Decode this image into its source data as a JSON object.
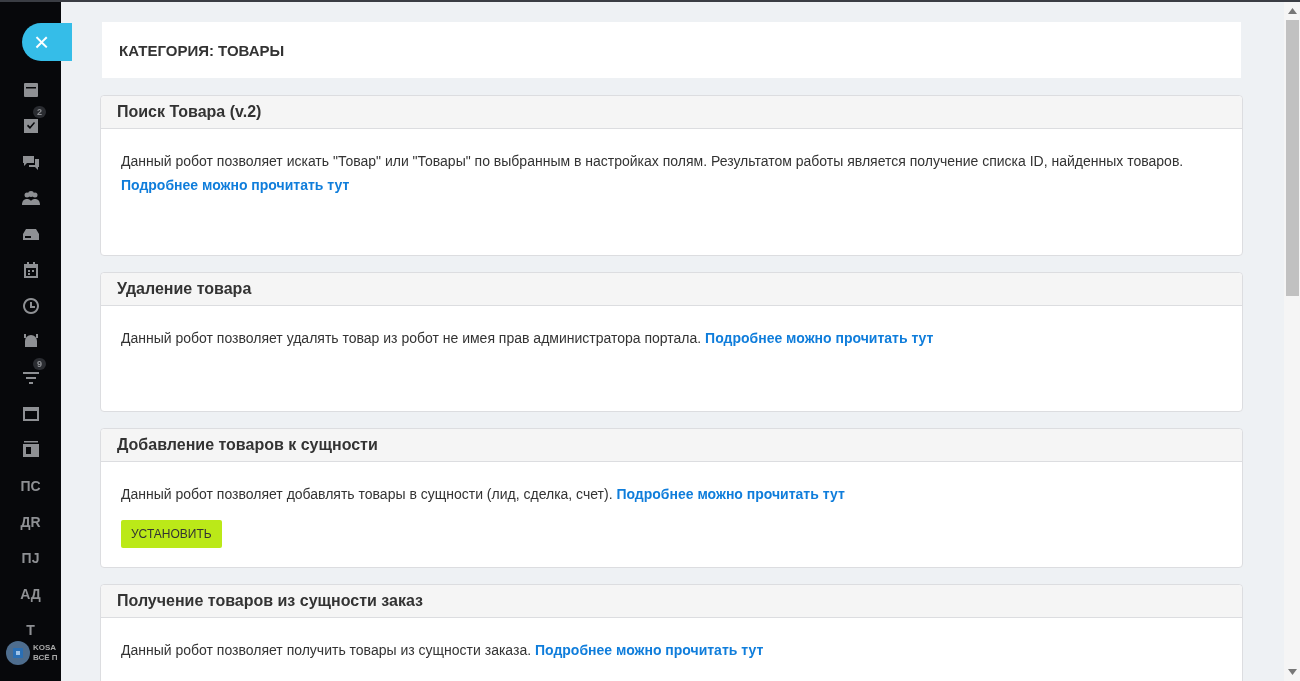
{
  "sidebar": {
    "items": [
      {
        "kind": "icon"
      },
      {
        "kind": "icon",
        "badge": "2"
      },
      {
        "kind": "icon"
      },
      {
        "kind": "icon"
      },
      {
        "kind": "icon"
      },
      {
        "kind": "icon"
      },
      {
        "kind": "icon"
      },
      {
        "kind": "icon"
      },
      {
        "kind": "icon",
        "badge": "9"
      },
      {
        "kind": "icon"
      },
      {
        "kind": "icon"
      },
      {
        "kind": "text",
        "label": "ПС"
      },
      {
        "kind": "text",
        "label": "ДR"
      },
      {
        "kind": "text",
        "label": "ПЈ"
      },
      {
        "kind": "text",
        "label": "АД"
      },
      {
        "kind": "text",
        "label": "Т"
      }
    ],
    "logo": {
      "line1": "KOSA",
      "line2": "ВСЁ П"
    }
  },
  "close_button": {
    "label": "×"
  },
  "page_title": "КАТЕГОРИЯ: ТОВАРЫ",
  "cards": [
    {
      "title": "Поиск Товара (v.2)",
      "text": "Данный робот позволяет искать \"Товар\" или \"Товары\" по выбранным в настройках полям. Результатом работы является получение списка ID, найденных товаров.",
      "link": "Подробнее можно прочитать тут"
    },
    {
      "title": "Удаление товара",
      "text": "Данный робот позволяет удалять товар из робот не имея прав администратора портала.",
      "link": "Подробнее можно прочитать тут"
    },
    {
      "title": "Добавление товаров к сущности",
      "text": "Данный робот позволяет добавлять товары в сущности (лид, сделка, счет).",
      "link": "Подробнее можно прочитать тут",
      "button": "УСТАНОВИТЬ"
    },
    {
      "title": "Получение товаров из сущности заказ",
      "text": "Данный робот позволяет получить товары из сущности заказа.",
      "link": "Подробнее можно прочитать тут"
    }
  ]
}
